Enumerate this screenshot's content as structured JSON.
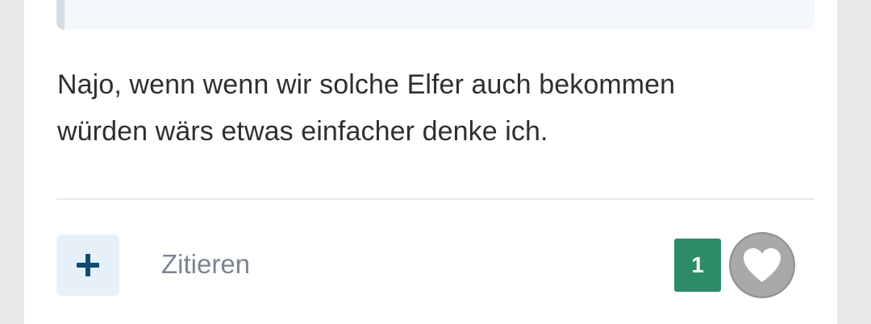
{
  "post": {
    "text_line1": "Najo, wenn wenn wir solche Elfer auch bekommen",
    "text_line2": "würden wärs etwas einfacher denke ich."
  },
  "footer": {
    "add_icon": "plus-icon",
    "quote_label": "Zitieren",
    "like_count": "1",
    "like_icon": "heart-icon"
  },
  "colors": {
    "like_badge": "#2e8b67",
    "add_button_bg": "#e6f0f9",
    "add_icon": "#0f4c75",
    "like_button_bg": "#a9a9a9"
  }
}
